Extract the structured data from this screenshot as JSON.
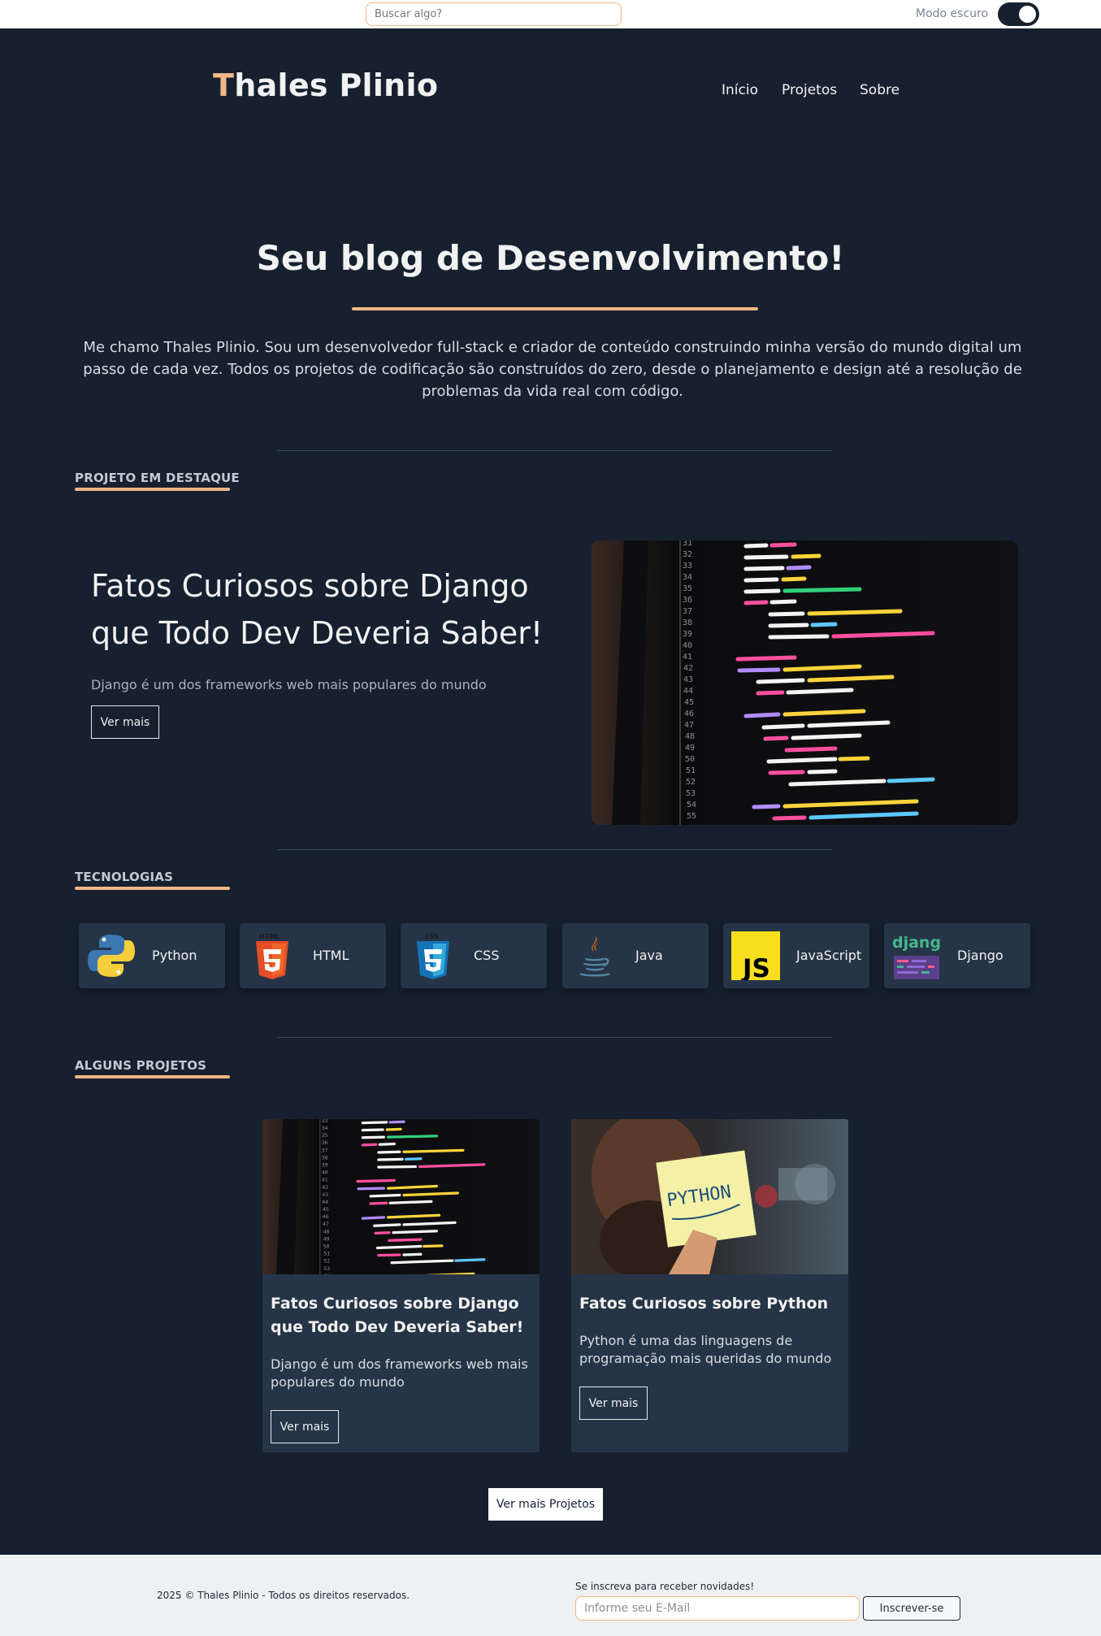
{
  "topbar": {
    "search_placeholder": "Buscar algo?",
    "dark_mode_label": "Modo escuro",
    "dark_mode_on": true
  },
  "header": {
    "logo_first_letter": "T",
    "logo_rest": "hales Plinio",
    "nav": [
      "Início",
      "Projetos",
      "Sobre"
    ]
  },
  "hero": {
    "title": "Seu blog de Desenvolvimento!",
    "text": "Me chamo Thales Plinio. Sou um desenvolvedor full-stack e criador de conteúdo construindo minha versão do mundo digital um passo de cada vez. Todos os projetos de codificação são construídos do zero, desde o planejamento e design até a resolução de problemas da vida real com código."
  },
  "featured": {
    "section_label": "PROJETO EM DESTAQUE",
    "title": "Fatos Curiosos sobre Django que Todo Dev Deveria Saber!",
    "description": "Django é um dos frameworks web mais populares do mundo",
    "button_label": "Ver mais"
  },
  "technologies": {
    "section_label": "TECNOLOGIAS",
    "items": [
      {
        "name": "Python",
        "icon": "python-icon"
      },
      {
        "name": "HTML",
        "icon": "html5-icon"
      },
      {
        "name": "CSS",
        "icon": "css3-icon"
      },
      {
        "name": "Java",
        "icon": "java-icon"
      },
      {
        "name": "JavaScript",
        "icon": "javascript-icon"
      },
      {
        "name": "Django",
        "icon": "django-icon"
      }
    ]
  },
  "projects": {
    "section_label": "ALGUNS PROJETOS",
    "items": [
      {
        "title": "Fatos Curiosos sobre Django que Todo Dev Deveria Saber!",
        "description": "Django é um dos frameworks web mais populares do mundo",
        "button_label": "Ver mais"
      },
      {
        "title": "Fatos Curiosos sobre Python",
        "description": "Python é uma das linguagens de programação mais queridas do mundo",
        "button_label": "Ver mais",
        "image_note_text": "PYTHON"
      }
    ],
    "more_button": "Ver mais Projetos"
  },
  "footer": {
    "copyright": "2025 © Thales Plinio - Todos os direitos reservados.",
    "newsletter_label": "Se inscreva para receber novidades!",
    "email_placeholder": "Informe seu E-Mail",
    "subscribe_button": "Inscrever-se"
  },
  "colors": {
    "background": "#16202f",
    "card": "#263447",
    "accent": "#f0b787"
  }
}
